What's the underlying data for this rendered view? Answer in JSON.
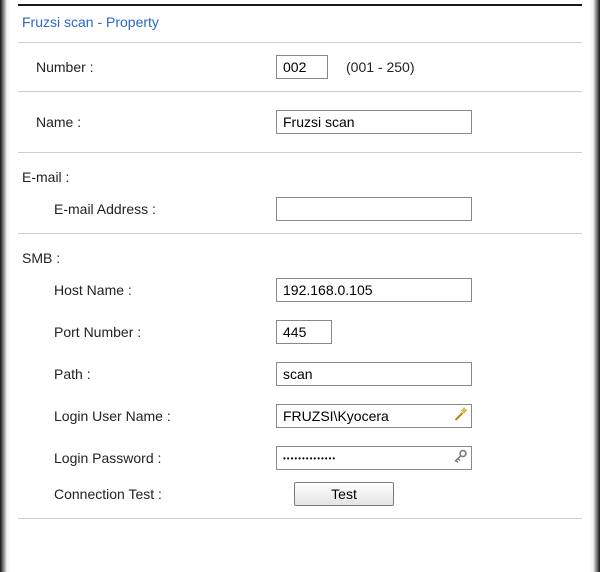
{
  "title": "Fruzsi scan - Property",
  "fields": {
    "number": {
      "label": "Number :",
      "value": "002",
      "hint": "(001 - 250)"
    },
    "name": {
      "label": "Name :",
      "value": "Fruzsi scan"
    },
    "email": {
      "section": "E-mail :",
      "address_label": "E-mail Address :",
      "value": ""
    },
    "smb": {
      "section": "SMB :"
    },
    "host": {
      "label": "Host Name :",
      "value": "192.168.0.105"
    },
    "port": {
      "label": "Port Number :",
      "value": "445"
    },
    "path": {
      "label": "Path :",
      "value": "scan"
    },
    "user": {
      "label": "Login User Name :",
      "value": "FRUZSI\\Kyocera"
    },
    "password": {
      "label": "Login Password :",
      "value": "••••••••••••••"
    },
    "conn_test": {
      "label": "Connection Test :",
      "button": "Test"
    }
  }
}
